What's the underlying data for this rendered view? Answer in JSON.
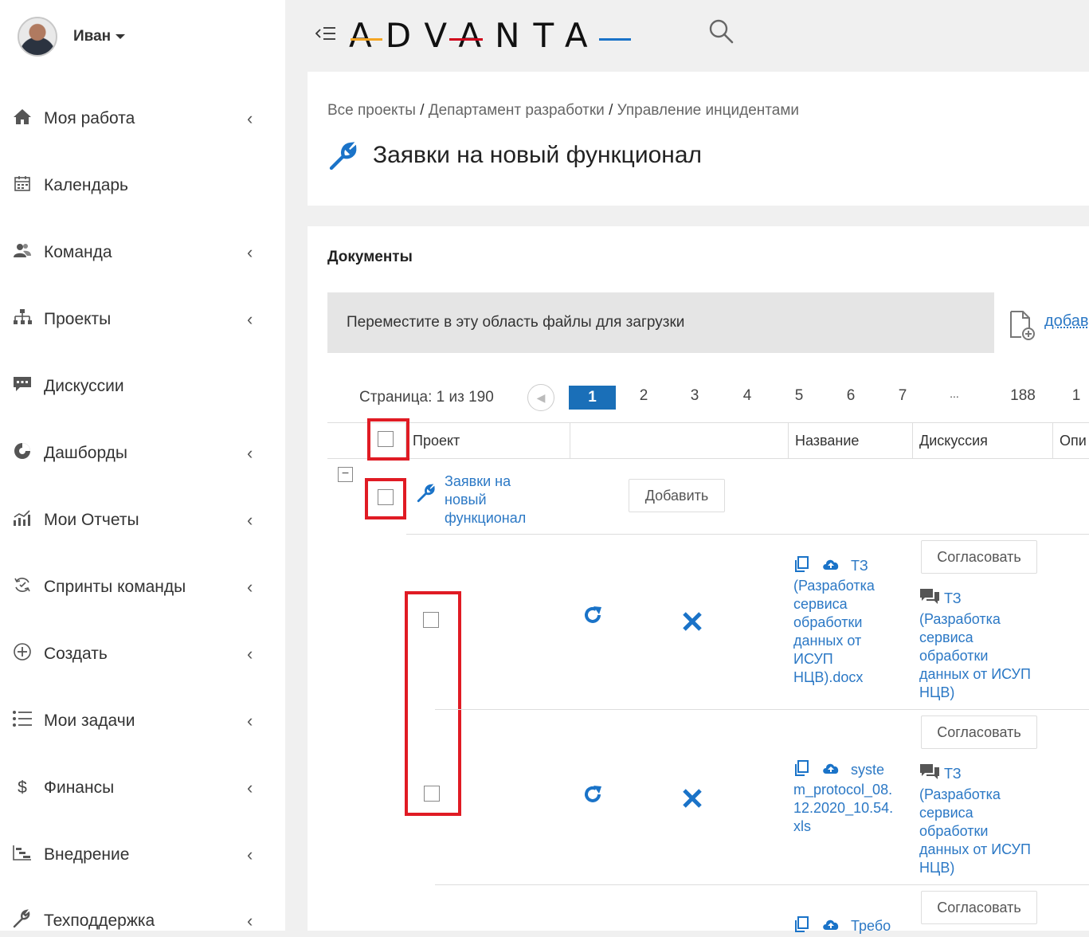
{
  "user": {
    "name": "Иван"
  },
  "sidebar": {
    "items": [
      {
        "label": "Моя работа",
        "icon": "home-icon",
        "glyph": "⌂",
        "chevron": "‹"
      },
      {
        "label": "Календарь",
        "icon": "calendar-icon",
        "glyph": "▦",
        "chevron": ""
      },
      {
        "label": "Команда",
        "icon": "team-icon",
        "glyph": "👥",
        "chevron": "‹"
      },
      {
        "label": "Проекты",
        "icon": "sitemap-icon",
        "glyph": "⊞",
        "chevron": "‹"
      },
      {
        "label": "Дискуссии",
        "icon": "comment-icon",
        "glyph": "💬",
        "chevron": ""
      },
      {
        "label": "Дашборды",
        "icon": "pie-chart-icon",
        "glyph": "◔",
        "chevron": "‹"
      },
      {
        "label": "Мои Отчеты",
        "icon": "bar-chart-icon",
        "glyph": "▟",
        "chevron": "‹"
      },
      {
        "label": "Спринты команды",
        "icon": "sprint-icon",
        "glyph": "↻",
        "chevron": "‹"
      },
      {
        "label": "Создать",
        "icon": "plus-circle-icon",
        "glyph": "⊕",
        "chevron": "‹"
      },
      {
        "label": "Мои задачи",
        "icon": "list-icon",
        "glyph": "☰",
        "chevron": "‹"
      },
      {
        "label": "Финансы",
        "icon": "dollar-icon",
        "glyph": "$",
        "chevron": "‹"
      },
      {
        "label": "Внедрение",
        "icon": "chart-steps-icon",
        "glyph": "⊏",
        "chevron": "‹"
      },
      {
        "label": "Техподдержка",
        "icon": "wrench-icon",
        "glyph": "✎",
        "chevron": "‹"
      }
    ]
  },
  "topbar": {
    "logo": "ADVANTA"
  },
  "header": {
    "breadcrumb": [
      "Все проекты",
      "Департамент разработки",
      "Управление инцидентами"
    ],
    "breadcrumb_sep": "/",
    "title": "Заявки на новый функционал"
  },
  "documents": {
    "title": "Документы",
    "dropzone_text": "Переместите в эту область файлы для загрузки",
    "add_link": "добав",
    "pager": {
      "label": "Страница: 1 из 190",
      "pages": [
        "1",
        "2",
        "3",
        "4",
        "5",
        "6",
        "7",
        "...",
        "188",
        "1"
      ],
      "current": "1"
    },
    "columns": {
      "project": "Проект",
      "blank": "",
      "name": "Название",
      "discussion": "Дискуссия",
      "description": "Опи"
    },
    "group": {
      "name": "Заявки на новый функционал",
      "add_button": "Добавить"
    },
    "rows": [
      {
        "file": "ТЗ (Разработка сервиса обработки данных от ИСУП НЦВ).docx",
        "file_lines": [
          "ТЗ",
          "(Разработка",
          "сервиса",
          "обработки",
          "данных от",
          "ИСУП",
          "НЦВ).docx"
        ],
        "approve": "Согласовать",
        "discussion_lines": [
          "ТЗ",
          "(Разработка",
          "сервиса",
          "обработки",
          "данных от ИСУП",
          "НЦВ)"
        ]
      },
      {
        "file": "system_protocol_08.12.2020_10.54.xls",
        "file_lines": [
          "syste",
          "m_protocol_08.",
          "12.2020_10.54.",
          "xls"
        ],
        "approve": "Согласовать",
        "discussion_lines": [
          "ТЗ",
          "(Разработка",
          "сервиса",
          "обработки",
          "данных от ИСУП",
          "НЦВ)"
        ]
      },
      {
        "file": "Требо",
        "file_lines": [
          "Требо"
        ],
        "approve": "Согласовать",
        "discussion_lines": []
      }
    ]
  },
  "colors": {
    "accent": "#1a73c8",
    "highlight": "#e01b24",
    "pager_active": "#1a6fb8"
  }
}
